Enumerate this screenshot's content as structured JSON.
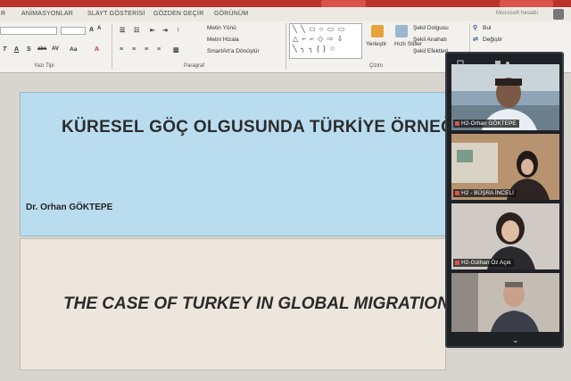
{
  "ribbon": {
    "tabs": [
      "R",
      "ANİMASYONLAR",
      "SLAYT GÖSTERİSİ",
      "GÖZDEN GEÇİR",
      "GÖRÜNÜM"
    ],
    "account": "Microsoft hesabı",
    "font_group_label": "Yazı Tipi",
    "paragraph_group_label": "Paragraf",
    "drawing_group_label": "Çizim",
    "text_direction": "Metin Yönü",
    "align_text": "Metni Hizala",
    "smartart": "SmartArt'a Dönüştür",
    "arrange": "Yerleştir",
    "quick_styles": "Hızlı Stiller",
    "shape_fill": "Şekil Dolgusu",
    "shape_outline": "Şekil Anahatı",
    "shape_effects": "Şekil Efektleri",
    "find": "Bul",
    "replace": "Değiştir",
    "font_symbols": [
      "T",
      "A",
      "S",
      "abc",
      "AV",
      "Aa",
      "A"
    ]
  },
  "slides": [
    {
      "title": "KÜRESEL GÖÇ OLGUSUNDA TÜRKİYE ÖRNEĞİ",
      "author": "Dr. Orhan GÖKTEPE"
    },
    {
      "title": "THE CASE OF TURKEY IN GLOBAL MIGRATION"
    }
  ],
  "participants": [
    {
      "name": "H2-Orhan GÖKTEPE"
    },
    {
      "name": "H2 - BÜŞRA İNCELİ"
    },
    {
      "name": "H2-Gülhan Öz Açık"
    },
    {
      "name": ""
    }
  ],
  "video_panel": {
    "collapse_symbol": "⌄"
  },
  "colors": {
    "slide1_bg": "#b9dcef",
    "slide2_bg": "#ece6dd",
    "ribbon_accent": "#b9332a"
  }
}
